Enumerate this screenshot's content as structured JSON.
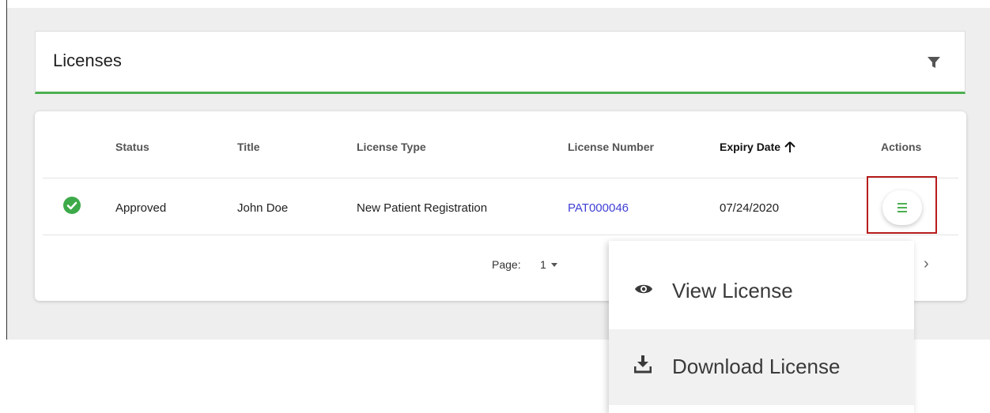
{
  "header": {
    "title": "Licenses"
  },
  "table": {
    "columns": {
      "status": "Status",
      "title": "Title",
      "license_type": "License Type",
      "license_number": "License Number",
      "expiry_date": "Expiry Date",
      "actions": "Actions"
    },
    "sorted_column": "expiry_date",
    "sort_direction": "ascending",
    "rows": [
      {
        "status_icon": "check-circle-icon",
        "status": "Approved",
        "title": "John Doe",
        "license_type": "New Patient Registration",
        "license_number": "PAT000046",
        "expiry_date": "07/24/2020"
      }
    ]
  },
  "pagination": {
    "label": "Page:",
    "value": "1"
  },
  "actions_menu": {
    "items": [
      {
        "label": "View License",
        "icon": "eye-icon"
      },
      {
        "label": "Download License",
        "icon": "download-icon"
      }
    ]
  },
  "colors": {
    "accent": "#4caf50",
    "status_approved": "#3daa4a",
    "link": "#3f3fd4",
    "highlight": "#b71c1c"
  }
}
